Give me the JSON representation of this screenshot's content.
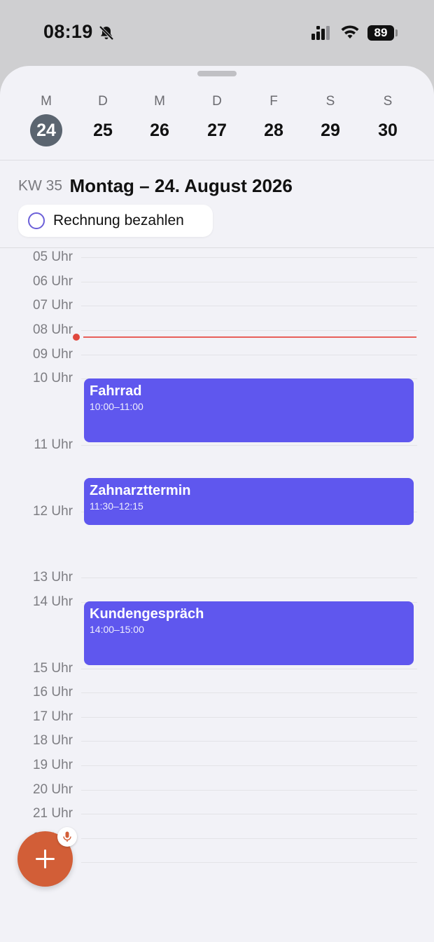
{
  "status_bar": {
    "time": "08:19",
    "battery": "89"
  },
  "week": {
    "days": [
      {
        "letter": "M",
        "number": "24",
        "selected": true
      },
      {
        "letter": "D",
        "number": "25"
      },
      {
        "letter": "M",
        "number": "26"
      },
      {
        "letter": "D",
        "number": "27"
      },
      {
        "letter": "F",
        "number": "28"
      },
      {
        "letter": "S",
        "number": "29"
      },
      {
        "letter": "S",
        "number": "30"
      }
    ]
  },
  "header": {
    "week_label": "KW 35",
    "date_title": "Montag – 24. August 2026"
  },
  "task": {
    "label": "Rechnung bezahlen"
  },
  "timeline": {
    "hours": [
      "05 Uhr",
      "06 Uhr",
      "07 Uhr",
      "08 Uhr",
      "09 Uhr",
      "10 Uhr",
      "11 Uhr",
      "12 Uhr",
      "13 Uhr",
      "14 Uhr",
      "15 Uhr",
      "16 Uhr",
      "17 Uhr",
      "18 Uhr",
      "19 Uhr",
      "20 Uhr",
      "21 Uhr",
      "22 Uhr"
    ],
    "events": [
      {
        "title": "Fahrrad",
        "time": "10:00–11:00"
      },
      {
        "title": "Zahnarzttermin",
        "time": "11:30–12:15"
      },
      {
        "title": "Kundengespräch",
        "time": "14:00–15:00"
      }
    ]
  },
  "colors": {
    "accent": "#5f57ee",
    "fab": "#d25e37",
    "now": "#e0483e",
    "selected_day": "#5b6570"
  },
  "icons": {
    "fab": "plus-icon",
    "badge": "microphone-icon",
    "status": [
      "bell-slash-icon",
      "cellular-icon",
      "wifi-icon"
    ]
  }
}
